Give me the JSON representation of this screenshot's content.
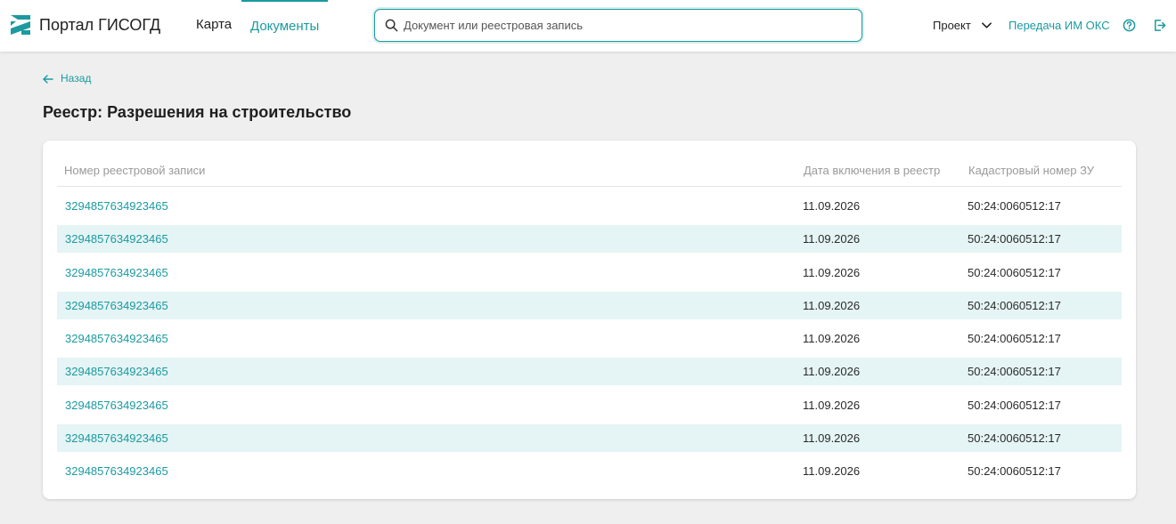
{
  "header": {
    "brand": "Портал ГИСОГД",
    "nav": {
      "map": "Карта",
      "documents": "Документы"
    },
    "search": {
      "placeholder": "Документ или реестровая запись",
      "value": ""
    },
    "project": "Проект",
    "transfer": "Передача ИМ ОКС",
    "accent": "#1b9aa0"
  },
  "main": {
    "back": "Назад",
    "title": "Реестр: Разрешения на строительство",
    "table": {
      "columns": [
        "Номер реестровой записи",
        "Дата включения в реестр",
        "Кадастровый номер ЗУ"
      ],
      "rows": [
        [
          "3294857634923465",
          "11.09.2026",
          "50:24:0060512:17"
        ],
        [
          "3294857634923465",
          "11.09.2026",
          "50:24:0060512:17"
        ],
        [
          "3294857634923465",
          "11.09.2026",
          "50:24:0060512:17"
        ],
        [
          "3294857634923465",
          "11.09.2026",
          "50:24:0060512:17"
        ],
        [
          "3294857634923465",
          "11.09.2026",
          "50:24:0060512:17"
        ],
        [
          "3294857634923465",
          "11.09.2026",
          "50:24:0060512:17"
        ],
        [
          "3294857634923465",
          "11.09.2026",
          "50:24:0060512:17"
        ],
        [
          "3294857634923465",
          "11.09.2026",
          "50:24:0060512:17"
        ],
        [
          "3294857634923465",
          "11.09.2026",
          "50:24:0060512:17"
        ]
      ]
    }
  }
}
